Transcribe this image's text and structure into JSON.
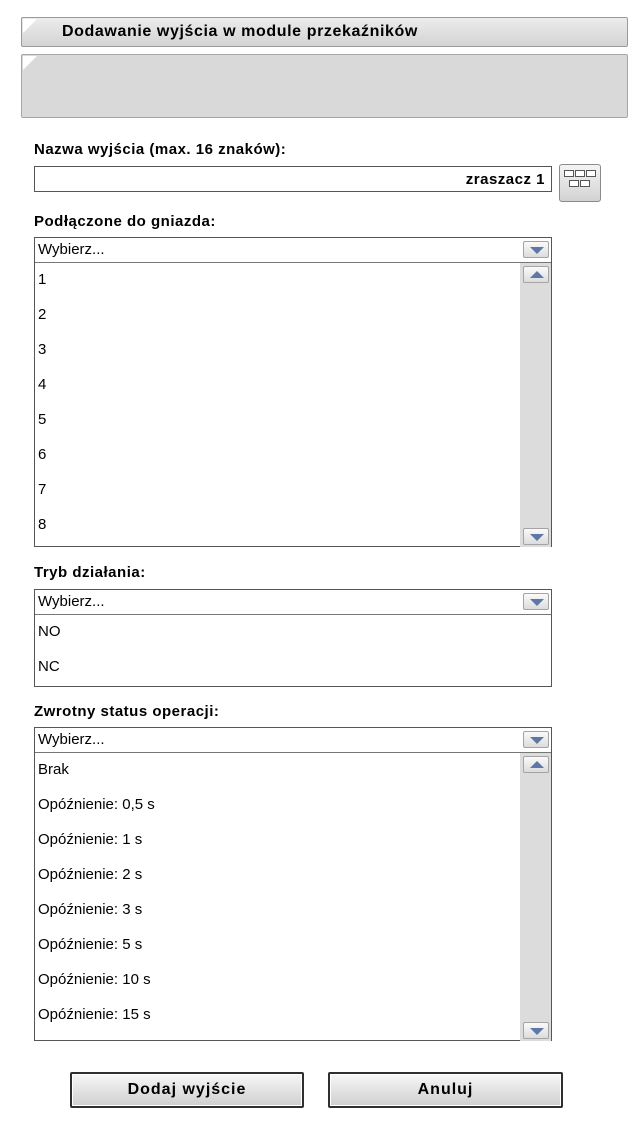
{
  "header": {
    "title": "Dodawanie wyjścia w module przekaźników"
  },
  "name_field": {
    "label": "Nazwa wyjścia (max. 16 znaków):",
    "value": "zraszacz 1",
    "keyboard_icon": "keyboard-icon"
  },
  "socket": {
    "label": "Podłączone do gniazda:",
    "selected": "Wybierz...",
    "options": [
      "1",
      "2",
      "3",
      "4",
      "5",
      "6",
      "7",
      "8"
    ]
  },
  "mode": {
    "label": "Tryb działania:",
    "selected": "Wybierz...",
    "options": [
      "NO",
      "NC"
    ]
  },
  "status": {
    "label": "Zwrotny status operacji:",
    "selected": "Wybierz...",
    "options": [
      "Brak",
      "Opóźnienie: 0,5 s",
      "Opóźnienie: 1 s",
      "Opóźnienie: 2 s",
      "Opóźnienie: 3 s",
      "Opóźnienie: 5 s",
      "Opóźnienie: 10 s",
      "Opóźnienie: 15 s"
    ]
  },
  "buttons": {
    "add": "Dodaj wyjście",
    "cancel": "Anuluj"
  },
  "colors": {
    "arrow": "#5d77a6",
    "scroll_track": "#dcdcdc",
    "header_bg": "#d9d9d9"
  }
}
